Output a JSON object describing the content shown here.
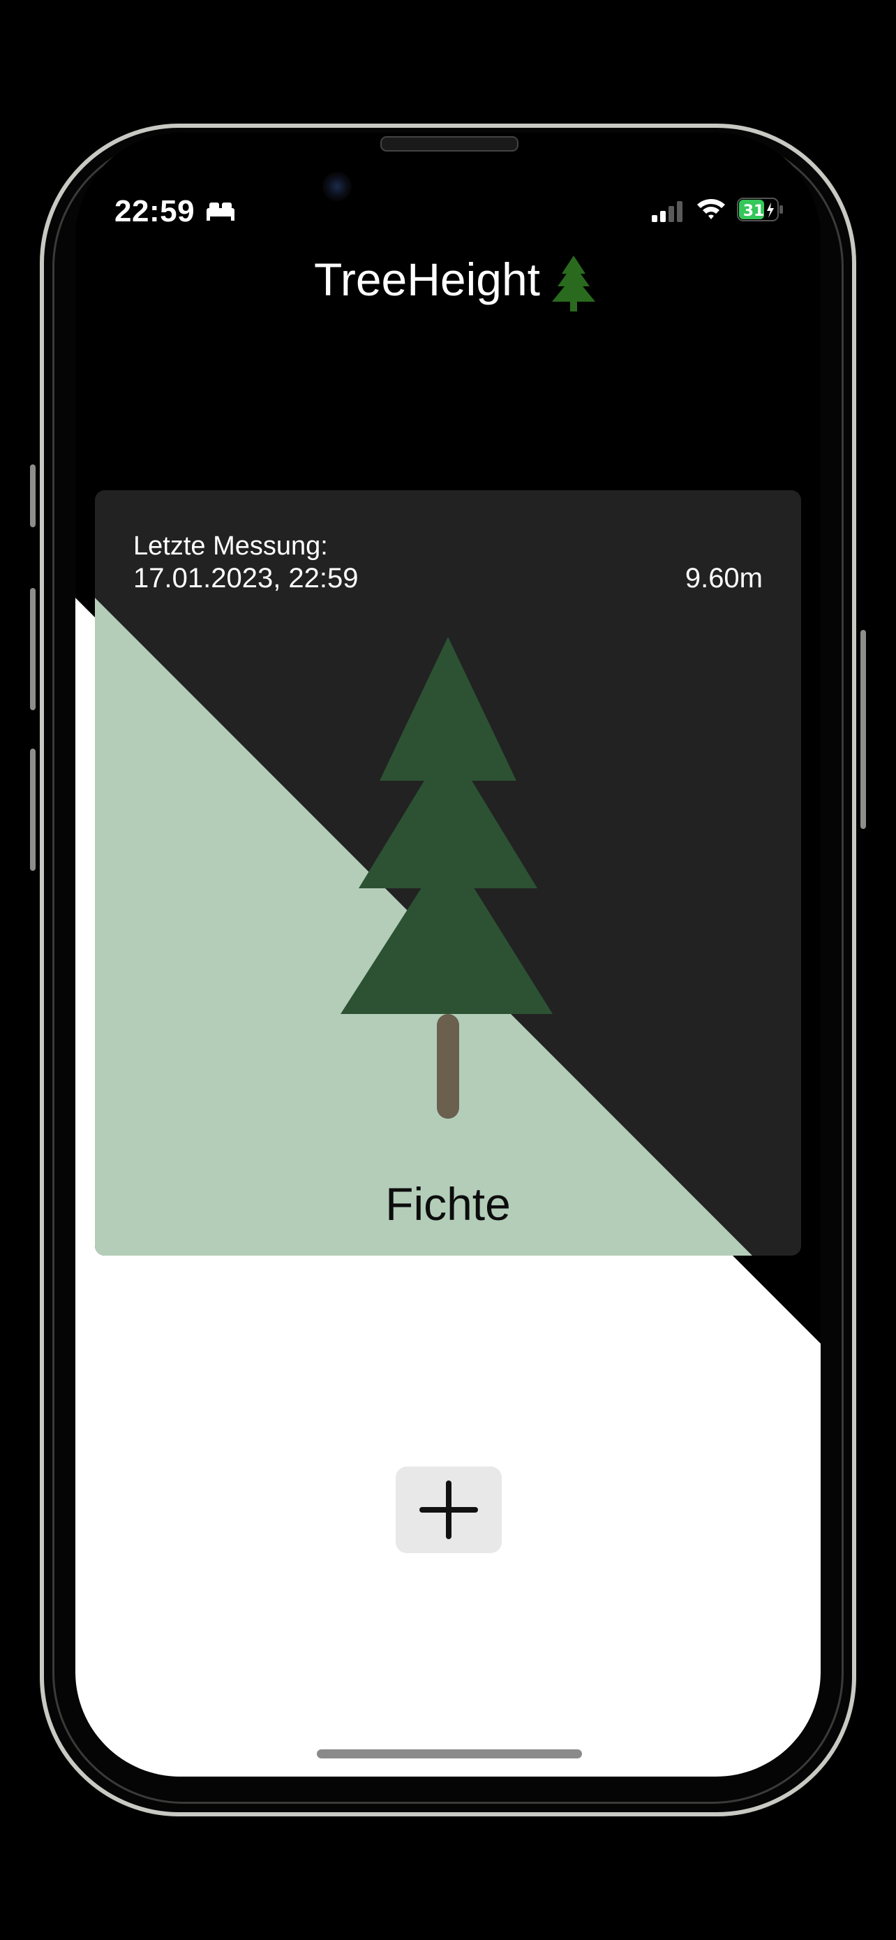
{
  "status_bar": {
    "time": "22:59",
    "focus_icon": "bed-icon",
    "battery_level": "31",
    "battery_color": "#34c759"
  },
  "nav": {
    "title": "TreeHeight",
    "title_icon": "tree-icon",
    "title_icon_color": "#2a6a1e"
  },
  "card": {
    "label": "Letzte Messung:",
    "date": "17.01.2023, 22:59",
    "height": "9.60m",
    "species": "Fichte",
    "colors": {
      "background": "#222222",
      "accent": "#b3cdb9",
      "tree": "#2c5233",
      "trunk": "#6b5f4e"
    }
  },
  "add_button": {
    "icon": "plus-icon"
  }
}
